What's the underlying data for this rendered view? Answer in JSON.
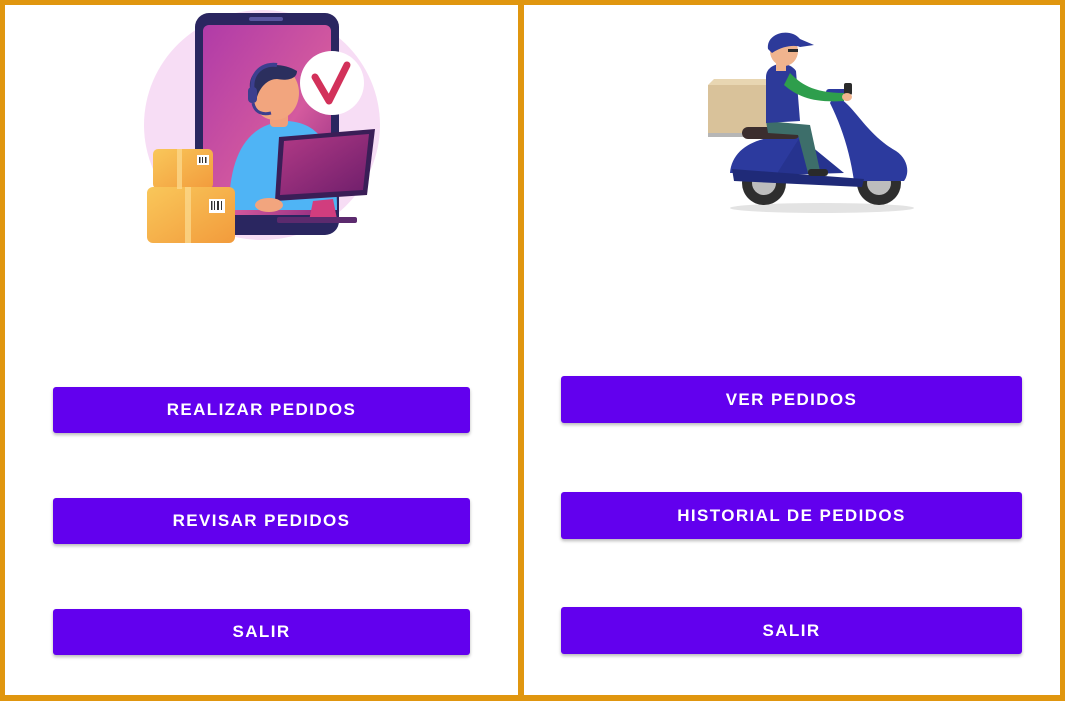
{
  "colors": {
    "frame": "#E0960F",
    "button": "#6200EE",
    "button_text": "#FFFFFF",
    "background": "#FFFFFF"
  },
  "left_screen": {
    "illustration": "customer-service-agent-illustration",
    "buttons": {
      "realizar_pedidos": "REALIZAR PEDIDOS",
      "revisar_pedidos": "REVISAR PEDIDOS",
      "salir": "SALIR"
    }
  },
  "right_screen": {
    "illustration": "delivery-scooter-illustration",
    "buttons": {
      "ver_pedidos": "VER PEDIDOS",
      "historial_pedidos": "HISTORIAL DE PEDIDOS",
      "salir": "SALIR"
    }
  }
}
